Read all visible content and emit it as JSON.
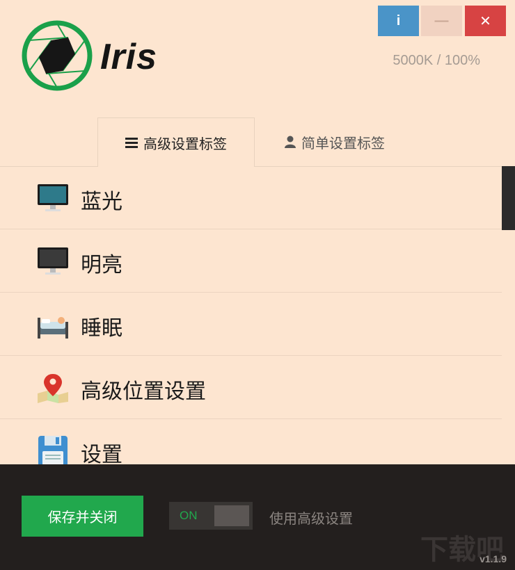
{
  "window": {
    "info_label": "i",
    "minimize_label": "—",
    "close_label": "✕",
    "app_name": "Iris",
    "temperature_readout": "5000K / 100%"
  },
  "tabs": [
    {
      "label": "高级设置标签",
      "icon": "hamburger-icon",
      "active": true
    },
    {
      "label": "简单设置标签",
      "icon": "user-icon",
      "active": false
    }
  ],
  "list": {
    "items": [
      {
        "label": "蓝光",
        "icon": "monitor-blue-icon"
      },
      {
        "label": "明亮",
        "icon": "monitor-dark-icon"
      },
      {
        "label": "睡眠",
        "icon": "bed-icon"
      },
      {
        "label": "高级位置设置",
        "icon": "map-pin-icon"
      },
      {
        "label": "设置",
        "icon": "floppy-disk-icon"
      }
    ]
  },
  "footer": {
    "save_button": "保存并关闭",
    "toggle_state": "ON",
    "advanced_label": "使用高级设置",
    "watermark": "下载吧",
    "version": "v1.1.9"
  },
  "colors": {
    "background": "#fde5d0",
    "info_button": "#4a94c8",
    "close_button": "#d74343",
    "accent_green": "#21a84d",
    "footer": "#231f1e"
  }
}
